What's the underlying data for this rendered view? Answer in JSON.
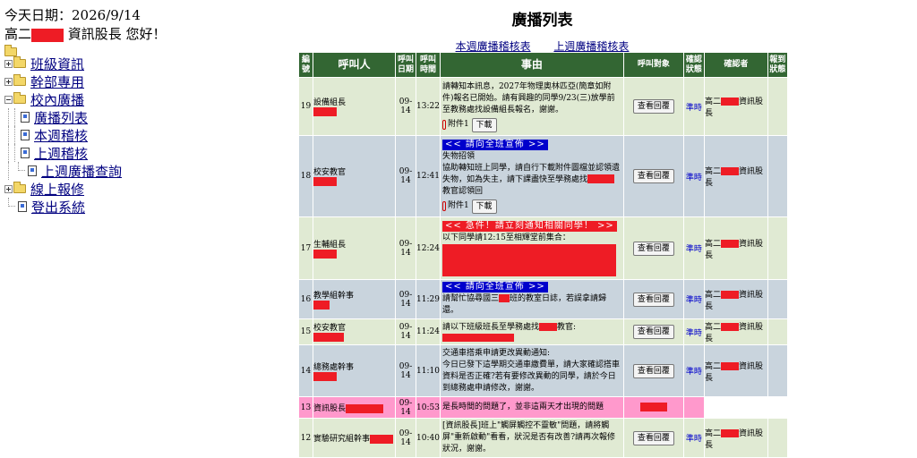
{
  "header": {
    "today_label": "今天日期：",
    "today_value": "2026/9/14",
    "greeting_prefix": "高二",
    "greeting_suffix": " 資訊股長 您好！"
  },
  "nav": {
    "class_info": "班級資訊",
    "cadre_only": "幹部專用",
    "campus_broadcast": "校內廣播",
    "broadcast_list": "廣播列表",
    "this_week_check": "本週稽核",
    "last_week_check": "上週稽核",
    "last_week_query": "上週廣播查詢",
    "online_repair": "線上報修",
    "logout": "登出系統"
  },
  "page": {
    "title": "廣播列表",
    "link_this_week": "本週廣播稽核表",
    "link_last_week": "上週廣播稽核表"
  },
  "table": {
    "headers": {
      "no": "編號",
      "caller": "呼叫人",
      "date": "呼叫日期",
      "time": "呼叫時間",
      "subject": "事由",
      "target": "呼叫對象",
      "confirm": "確認狀態",
      "confirmer": "確認者",
      "report": "報到狀態"
    },
    "view_reply_label": "查看回覆",
    "download_label": "下載",
    "ontime_label": "準時",
    "confirmer_prefix": "高二",
    "confirmer_suffix": "資訊股長",
    "rows": [
      {
        "no": "19",
        "caller": "設備組長",
        "date": "09-14",
        "time": "13:22",
        "msg": "請轉知本訊息，2027年物理奧林匹亞(簡章如附件)報名已開始。請有興趣的同學9/23(三)放學前至教務處找設備組長報名，謝謝。",
        "attach": "附件1"
      },
      {
        "no": "18",
        "caller": "校安教官",
        "date": "09-14",
        "time": "12:41",
        "banner": "<< 請向全班宣佈 >>",
        "msg_line1": "失物招領",
        "msg_a": "協助轉知班上同學，請自行下載附件圖檔並認領遺失物，如為失主，請下課盡快至學務處找",
        "msg_b": "教官認領回",
        "attach": "附件1"
      },
      {
        "no": "17",
        "caller": "生輔組長",
        "date": "09-14",
        "time": "12:24",
        "banner": "<< 急件！請立刻通知相關同學！ >>",
        "msg": "以下同學請12:15至相輝堂前集合："
      },
      {
        "no": "16",
        "caller": "教學組幹事",
        "date": "09-14",
        "time": "11:29",
        "banner": "<< 請向全班宣佈 >>",
        "msg_a": "請幫忙協尋國三",
        "msg_b": "班的教室日誌，若誤拿請歸還。"
      },
      {
        "no": "15",
        "caller": "校安教官",
        "date": "09-14",
        "time": "11:24",
        "msg_a": "請以下班級班長至學務處找",
        "msg_b": "教官:"
      },
      {
        "no": "14",
        "caller": "總務處幹事",
        "date": "09-14",
        "time": "11:10",
        "msg_line1": "交通車搭乘申請更改異動通知:",
        "msg": "今日已發下這學期交通車繳費單，請大家確認搭車資料是否正確?若有要修改異動的同學，請於今日到總務處申請修改，謝謝。"
      },
      {
        "no": "13",
        "caller": "資訊股長",
        "date": "09-14",
        "time": "10:53",
        "msg": "是長時間的問題了，並非這兩天才出現的問題"
      },
      {
        "no": "12",
        "caller": "實驗研究組幹事",
        "date": "09-14",
        "time": "10:40",
        "msg": "[資訊股長]班上\"觸屏觸控不靈敏\"問題，請將觸屏\"重新啟動\"看看，狀況是否有改善?請再次報修狀況，謝謝。"
      }
    ]
  },
  "colors": {
    "header_green": "#336633",
    "row_green": "#e0ead3",
    "row_blue": "#c9d4dd",
    "row_pink": "#ff99cc",
    "redaction": "#ee1c25",
    "link_navy": "#000080"
  }
}
